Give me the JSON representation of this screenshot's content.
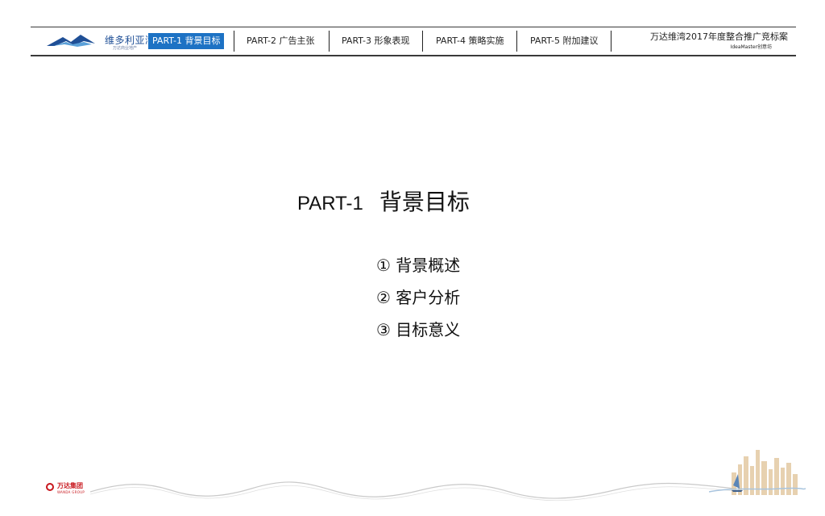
{
  "header": {
    "logo_text": "维多利亚湾",
    "logo_sub": "万达商业地产",
    "tabs": [
      {
        "label": "PART-1 背景目标",
        "active": true
      },
      {
        "label": "PART-2 广告主张",
        "active": false
      },
      {
        "label": "PART-3 形象表现",
        "active": false
      },
      {
        "label": "PART-4 策略实施",
        "active": false
      },
      {
        "label": "PART-5 附加建议",
        "active": false
      }
    ],
    "doc_title": "万达维湾2017年度整合推广竞标案",
    "doc_sub": "IdeaMaster创意坊"
  },
  "main": {
    "part_label": "PART-1",
    "part_name": "背景目标",
    "items": [
      "① 背景概述",
      "② 客户分析",
      "③ 目标意义"
    ]
  },
  "footer": {
    "brand": "万达集团",
    "brand_sub": "WANDA GROUP"
  },
  "colors": {
    "accent": "#1d72c4",
    "logo_blue": "#1f4f96",
    "brand_red": "#c8161d"
  }
}
